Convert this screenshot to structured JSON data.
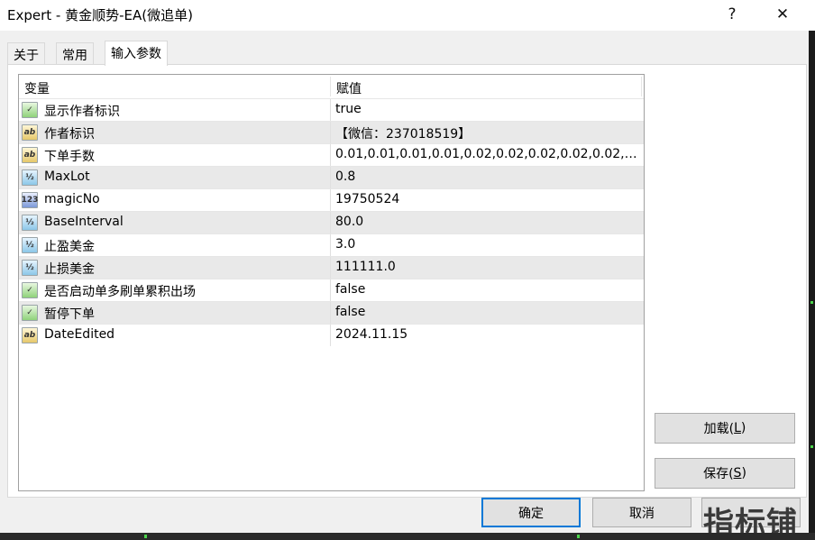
{
  "window": {
    "title": "Expert - 黄金顺势-EA(微追单)",
    "help_label": "?",
    "close_label": "✕"
  },
  "tabs": [
    {
      "label": "关于",
      "active": false
    },
    {
      "label": "常用",
      "active": false
    },
    {
      "label": "输入参数",
      "active": true
    }
  ],
  "grid": {
    "columns": {
      "variable": "变量",
      "value": "赋值"
    },
    "rows": [
      {
        "type": "bool",
        "icon": "bool-icon",
        "name": "显示作者标识",
        "value": "true"
      },
      {
        "type": "string",
        "icon": "string-icon",
        "name": "作者标识",
        "value": "【微信：237018519】"
      },
      {
        "type": "string",
        "icon": "string-icon",
        "name": "下单手数",
        "value": "0.01,0.01,0.01,0.01,0.02,0.02,0.02,0.02,0.02,0..."
      },
      {
        "type": "double",
        "icon": "double-icon",
        "name": "MaxLot",
        "value": "0.8"
      },
      {
        "type": "int",
        "icon": "int-icon",
        "name": "magicNo",
        "value": "19750524"
      },
      {
        "type": "double",
        "icon": "double-icon",
        "name": "BaseInterval",
        "value": "80.0"
      },
      {
        "type": "double",
        "icon": "double-icon",
        "name": "止盈美金",
        "value": "3.0"
      },
      {
        "type": "double",
        "icon": "double-icon",
        "name": "止损美金",
        "value": "111111.0"
      },
      {
        "type": "bool",
        "icon": "bool-icon",
        "name": "是否启动单多刷单累积出场",
        "value": "false"
      },
      {
        "type": "bool",
        "icon": "bool-icon",
        "name": "暂停下单",
        "value": "false"
      },
      {
        "type": "string",
        "icon": "string-icon",
        "name": "DateEdited",
        "value": "2024.11.15"
      }
    ]
  },
  "icon_glyphs": {
    "bool": "✓",
    "string": "ab",
    "double": "½",
    "int": "123"
  },
  "buttons": {
    "load": {
      "text": "加载(",
      "key": "L",
      "suffix": ")"
    },
    "save": {
      "text": "保存(",
      "key": "S",
      "suffix": ")"
    },
    "ok": "确定",
    "cancel": "取消",
    "reset": ""
  },
  "watermark": "指标铺",
  "colors": {
    "accent": "#0078d7",
    "row_alt": "#e9e9e9",
    "chart_tick": "#4bd44b"
  }
}
